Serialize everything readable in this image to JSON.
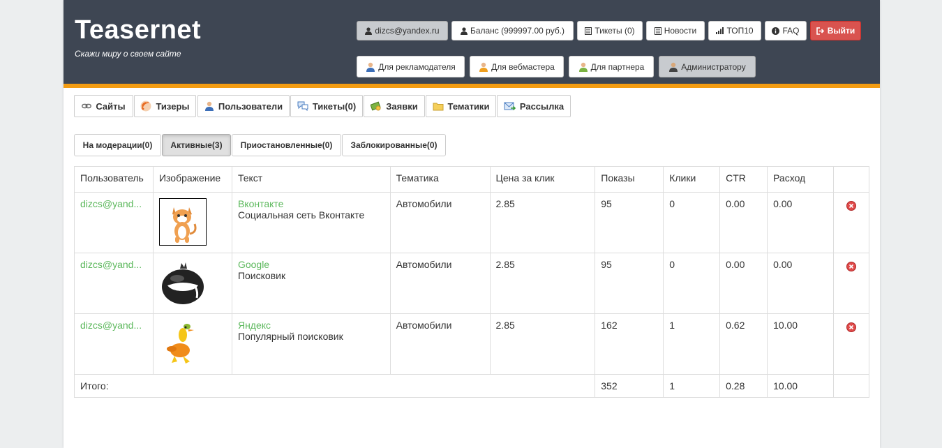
{
  "header": {
    "logo": "Teasernet",
    "slogan": "Скажи миру о своем сайте",
    "top_buttons": {
      "email": "dizcs@yandex.ru",
      "balance": "Баланс (999997.00 руб.)",
      "tickets": "Тикеты (0)",
      "news": "Новости",
      "top10": "ТОП10",
      "faq": "FAQ",
      "logout": "Выйти"
    },
    "role_buttons": {
      "advertiser": "Для рекламодателя",
      "webmaster": "Для вебмастера",
      "partner": "Для партнера",
      "admin": "Администратору"
    }
  },
  "nav_tabs": {
    "sites": "Сайты",
    "teasers": "Тизеры",
    "users": "Пользователи",
    "tickets": "Тикеты(0)",
    "requests": "Заявки",
    "topics": "Тематики",
    "mailing": "Рассылка"
  },
  "sub_tabs": {
    "moderation": "На модерации(0)",
    "active": "Активные(3)",
    "paused": "Приостановленные(0)",
    "blocked": "Заблокированные(0)"
  },
  "table": {
    "headers": [
      "Пользователь",
      "Изображение",
      "Текст",
      "Тематика",
      "Цена за клик",
      "Показы",
      "Клики",
      "CTR",
      "Расход"
    ],
    "rows": [
      {
        "user": "dizcs@yand...",
        "image": "kitten-image",
        "title": "Вконтакте",
        "desc": "Социальная сеть Вконтакте",
        "topic": "Автомобили",
        "price": "2.85",
        "shows": "95",
        "clicks": "0",
        "ctr": "0.00",
        "cost": "0.00"
      },
      {
        "user": "dizcs@yand...",
        "image": "black-ball-image",
        "title": "Google",
        "desc": "Поисковик",
        "topic": "Автомобили",
        "price": "2.85",
        "shows": "95",
        "clicks": "0",
        "ctr": "0.00",
        "cost": "0.00"
      },
      {
        "user": "dizcs@yand...",
        "image": "duck-image",
        "title": "Яндекс",
        "desc": "Популярный поисковик",
        "topic": "Автомобили",
        "price": "2.85",
        "shows": "162",
        "clicks": "1",
        "ctr": "0.62",
        "cost": "10.00"
      }
    ],
    "total": {
      "label": "Итого:",
      "shows": "352",
      "clicks": "1",
      "ctr": "0.28",
      "cost": "10.00"
    }
  },
  "colors": {
    "header_bg": "#3e4653",
    "accent_orange": "#f39c12",
    "link_green": "#5cb85c",
    "logout_red": "#d9534f"
  }
}
